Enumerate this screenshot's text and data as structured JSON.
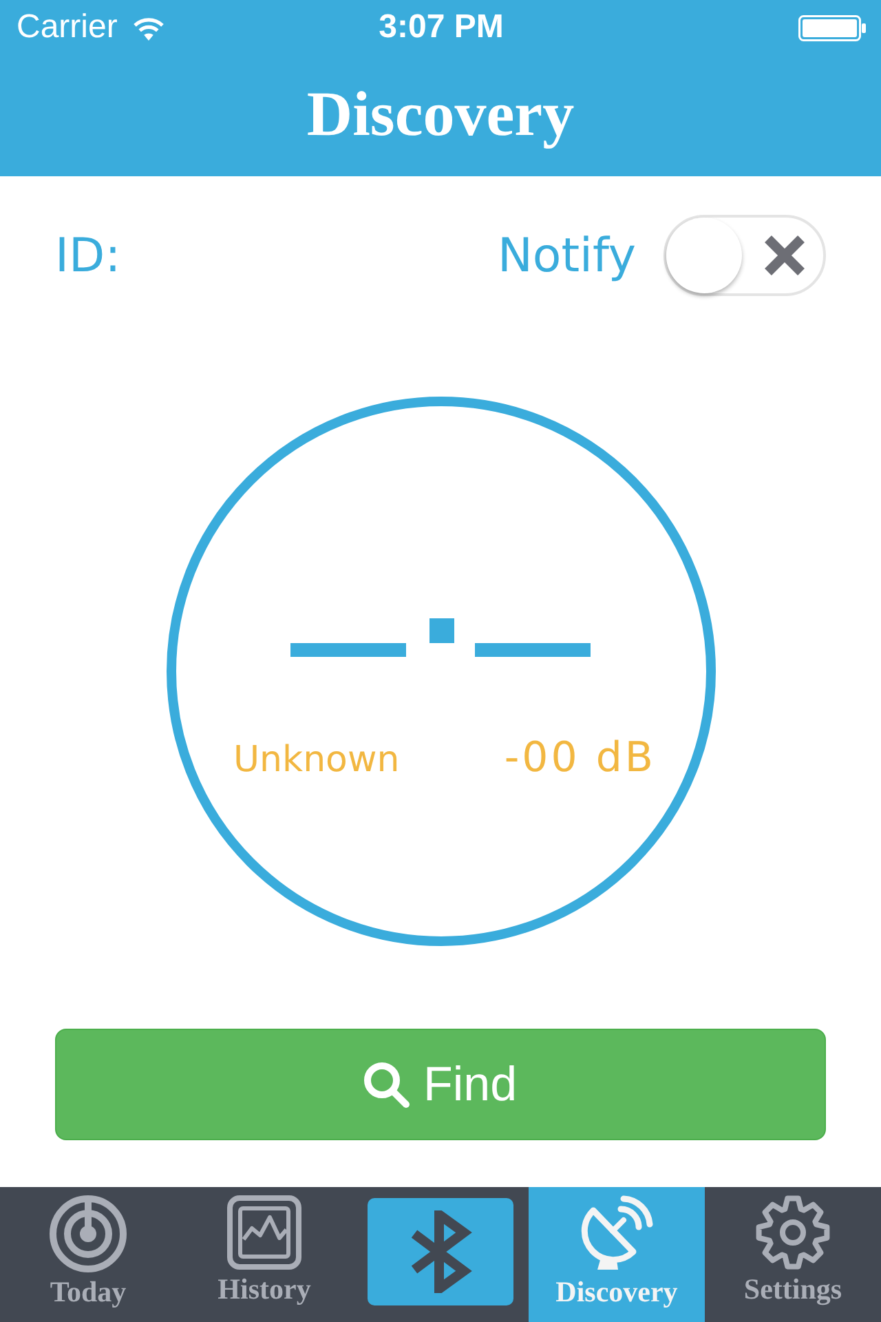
{
  "status_bar": {
    "carrier": "Carrier",
    "time": "3:07 PM"
  },
  "nav_bar": {
    "title": "Discovery"
  },
  "device": {
    "id_label": "ID:"
  },
  "notify": {
    "label": "Notify",
    "on": false
  },
  "gauge": {
    "proximity": "Unknown",
    "signal": "-00 dB"
  },
  "find_button": {
    "label": "Find"
  },
  "tabs": [
    {
      "kind": "tab",
      "label": "Today",
      "selected": false
    },
    {
      "kind": "tab",
      "label": "History",
      "selected": false
    },
    {
      "kind": "action",
      "selected": false
    },
    {
      "kind": "tab",
      "label": "Discovery",
      "selected": true
    },
    {
      "kind": "tab",
      "label": "Settings",
      "selected": false
    }
  ]
}
